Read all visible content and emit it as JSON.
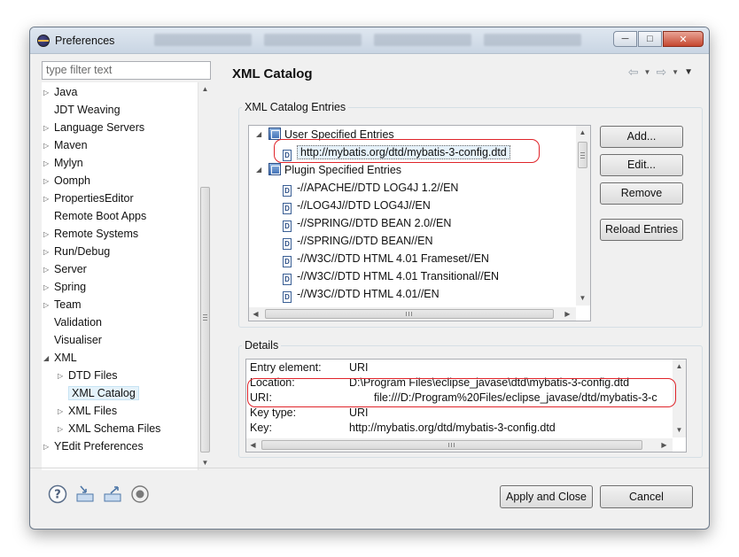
{
  "window": {
    "title": "Preferences",
    "minimize_icon": "minimize-icon",
    "maximize_icon": "maximize-icon",
    "close_icon": "close-icon"
  },
  "filter": {
    "placeholder": "type filter text"
  },
  "nav": {
    "items": [
      {
        "label": "Java",
        "expandable": true
      },
      {
        "label": "JDT Weaving",
        "expandable": false
      },
      {
        "label": "Language Servers",
        "expandable": true
      },
      {
        "label": "Maven",
        "expandable": true
      },
      {
        "label": "Mylyn",
        "expandable": true
      },
      {
        "label": "Oomph",
        "expandable": true
      },
      {
        "label": "PropertiesEditor",
        "expandable": true
      },
      {
        "label": "Remote Boot Apps",
        "expandable": false
      },
      {
        "label": "Remote Systems",
        "expandable": true
      },
      {
        "label": "Run/Debug",
        "expandable": true
      },
      {
        "label": "Server",
        "expandable": true
      },
      {
        "label": "Spring",
        "expandable": true
      },
      {
        "label": "Team",
        "expandable": true
      },
      {
        "label": "Validation",
        "expandable": false
      },
      {
        "label": "Visualiser",
        "expandable": false
      },
      {
        "label": "XML",
        "expandable": true,
        "expanded": true
      },
      {
        "label": "DTD Files",
        "expandable": true,
        "child": true
      },
      {
        "label": "XML Catalog",
        "expandable": false,
        "child": true,
        "selected": true
      },
      {
        "label": "XML Files",
        "expandable": true,
        "child": true
      },
      {
        "label": "XML Schema Files",
        "expandable": true,
        "child": true
      },
      {
        "label": "YEdit Preferences",
        "expandable": true
      }
    ]
  },
  "page": {
    "title": "XML Catalog",
    "back_icon": "back-arrow-icon",
    "forward_icon": "forward-arrow-icon",
    "view_menu_icon": "view-menu-icon"
  },
  "catalog": {
    "group_label": "XML Catalog Entries",
    "user_root": "User Specified Entries",
    "user_entries": [
      "http://mybatis.org/dtd/mybatis-3-config.dtd"
    ],
    "plugin_root": "Plugin Specified Entries",
    "plugin_entries": [
      "-//APACHE//DTD LOG4J 1.2//EN",
      "-//LOG4J//DTD LOG4J//EN",
      "-//SPRING//DTD BEAN 2.0//EN",
      "-//SPRING//DTD BEAN//EN",
      "-//W3C//DTD HTML 4.01 Frameset//EN",
      "-//W3C//DTD HTML 4.01 Transitional//EN",
      "-//W3C//DTD HTML 4.01//EN"
    ],
    "buttons": {
      "add": "Add...",
      "edit": "Edit...",
      "remove": "Remove",
      "reload": "Reload Entries"
    }
  },
  "details": {
    "group_label": "Details",
    "rows": [
      {
        "key": "Entry element:",
        "value": "URI"
      },
      {
        "key": "Location:",
        "value": "D:\\Program Files\\eclipse_javase\\dtd\\mybatis-3-config.dtd"
      },
      {
        "key": "URI:",
        "value": "file:///D:/Program%20Files/eclipse_javase/dtd/mybatis-3-c"
      },
      {
        "key": "Key type:",
        "value": "URI"
      },
      {
        "key": "Key:",
        "value": "http://mybatis.org/dtd/mybatis-3-config.dtd"
      }
    ]
  },
  "footer": {
    "help_icon": "help-icon",
    "import_icon": "import-icon",
    "export_icon": "export-icon",
    "record_icon": "record-icon",
    "apply_close": "Apply and Close",
    "cancel": "Cancel"
  },
  "colors": {
    "highlight_ring": "#e0242a",
    "selection": "#e5f3fb"
  }
}
